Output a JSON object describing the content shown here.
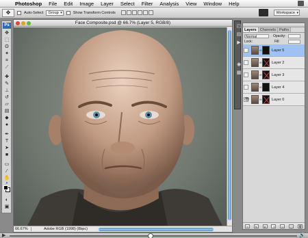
{
  "menubar": {
    "app_name": "Photoshop",
    "items": [
      "File",
      "Edit",
      "Image",
      "Layer",
      "Select",
      "Filter",
      "Analysis",
      "View",
      "Window",
      "Help"
    ]
  },
  "options": {
    "auto_select_label": "Auto-Select",
    "auto_select_target": "Group",
    "transform_controls_label": "Show Transform Controls",
    "workspace_label": "Workspace"
  },
  "document": {
    "title": "Face Composite.psd @ 66.7% (Layer 5, RGB/8)",
    "zoom": "66.67%",
    "profile": "Adobe RGB (1998) (8bpc)"
  },
  "toolbox": {
    "logo": "Ps"
  },
  "palette": {
    "tabs": [
      "Layers",
      "Channels",
      "Paths"
    ],
    "blend_mode": "Normal",
    "opacity_label": "Opacity:",
    "lock_label": "Lock:",
    "fill_label": "Fill:",
    "layers": [
      {
        "name": "Layer 5",
        "selected": true,
        "visible": false
      },
      {
        "name": "Layer 2",
        "selected": false,
        "visible": false
      },
      {
        "name": "Layer 3",
        "selected": false,
        "visible": false
      },
      {
        "name": "Layer 4",
        "selected": false,
        "visible": false
      },
      {
        "name": "Layer 0",
        "selected": false,
        "visible": true
      }
    ]
  },
  "player": {
    "progress": 0.49
  }
}
